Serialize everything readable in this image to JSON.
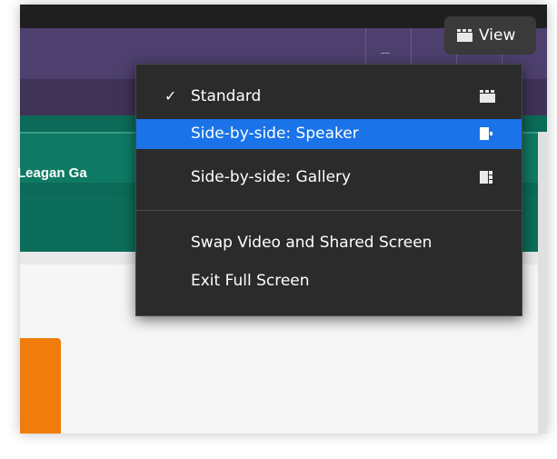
{
  "participant": {
    "name": "Leagan Ga"
  },
  "view_button": {
    "label": "View",
    "icon": "standard-view-icon"
  },
  "view_menu": {
    "items": [
      {
        "label": "Standard",
        "checked": true,
        "selected": false,
        "icon": "standard-view-icon"
      },
      {
        "label": "Side-by-side: Speaker",
        "checked": false,
        "selected": true,
        "icon": "side-by-side-speaker-icon"
      },
      {
        "label": "Side-by-side: Gallery",
        "checked": false,
        "selected": false,
        "icon": "side-by-side-gallery-icon"
      },
      {
        "label": "Swap Video and Shared Screen",
        "checked": false,
        "selected": false,
        "icon": ""
      },
      {
        "label": "Exit Full Screen",
        "checked": false,
        "selected": false,
        "icon": ""
      }
    ],
    "check_glyph": "✓"
  },
  "colors": {
    "header_purple": "#4d3f6e",
    "teal": "#0b6b58",
    "menu_bg": "#2b2b2b",
    "highlight": "#1a73e8",
    "orange": "#f07d0b"
  }
}
